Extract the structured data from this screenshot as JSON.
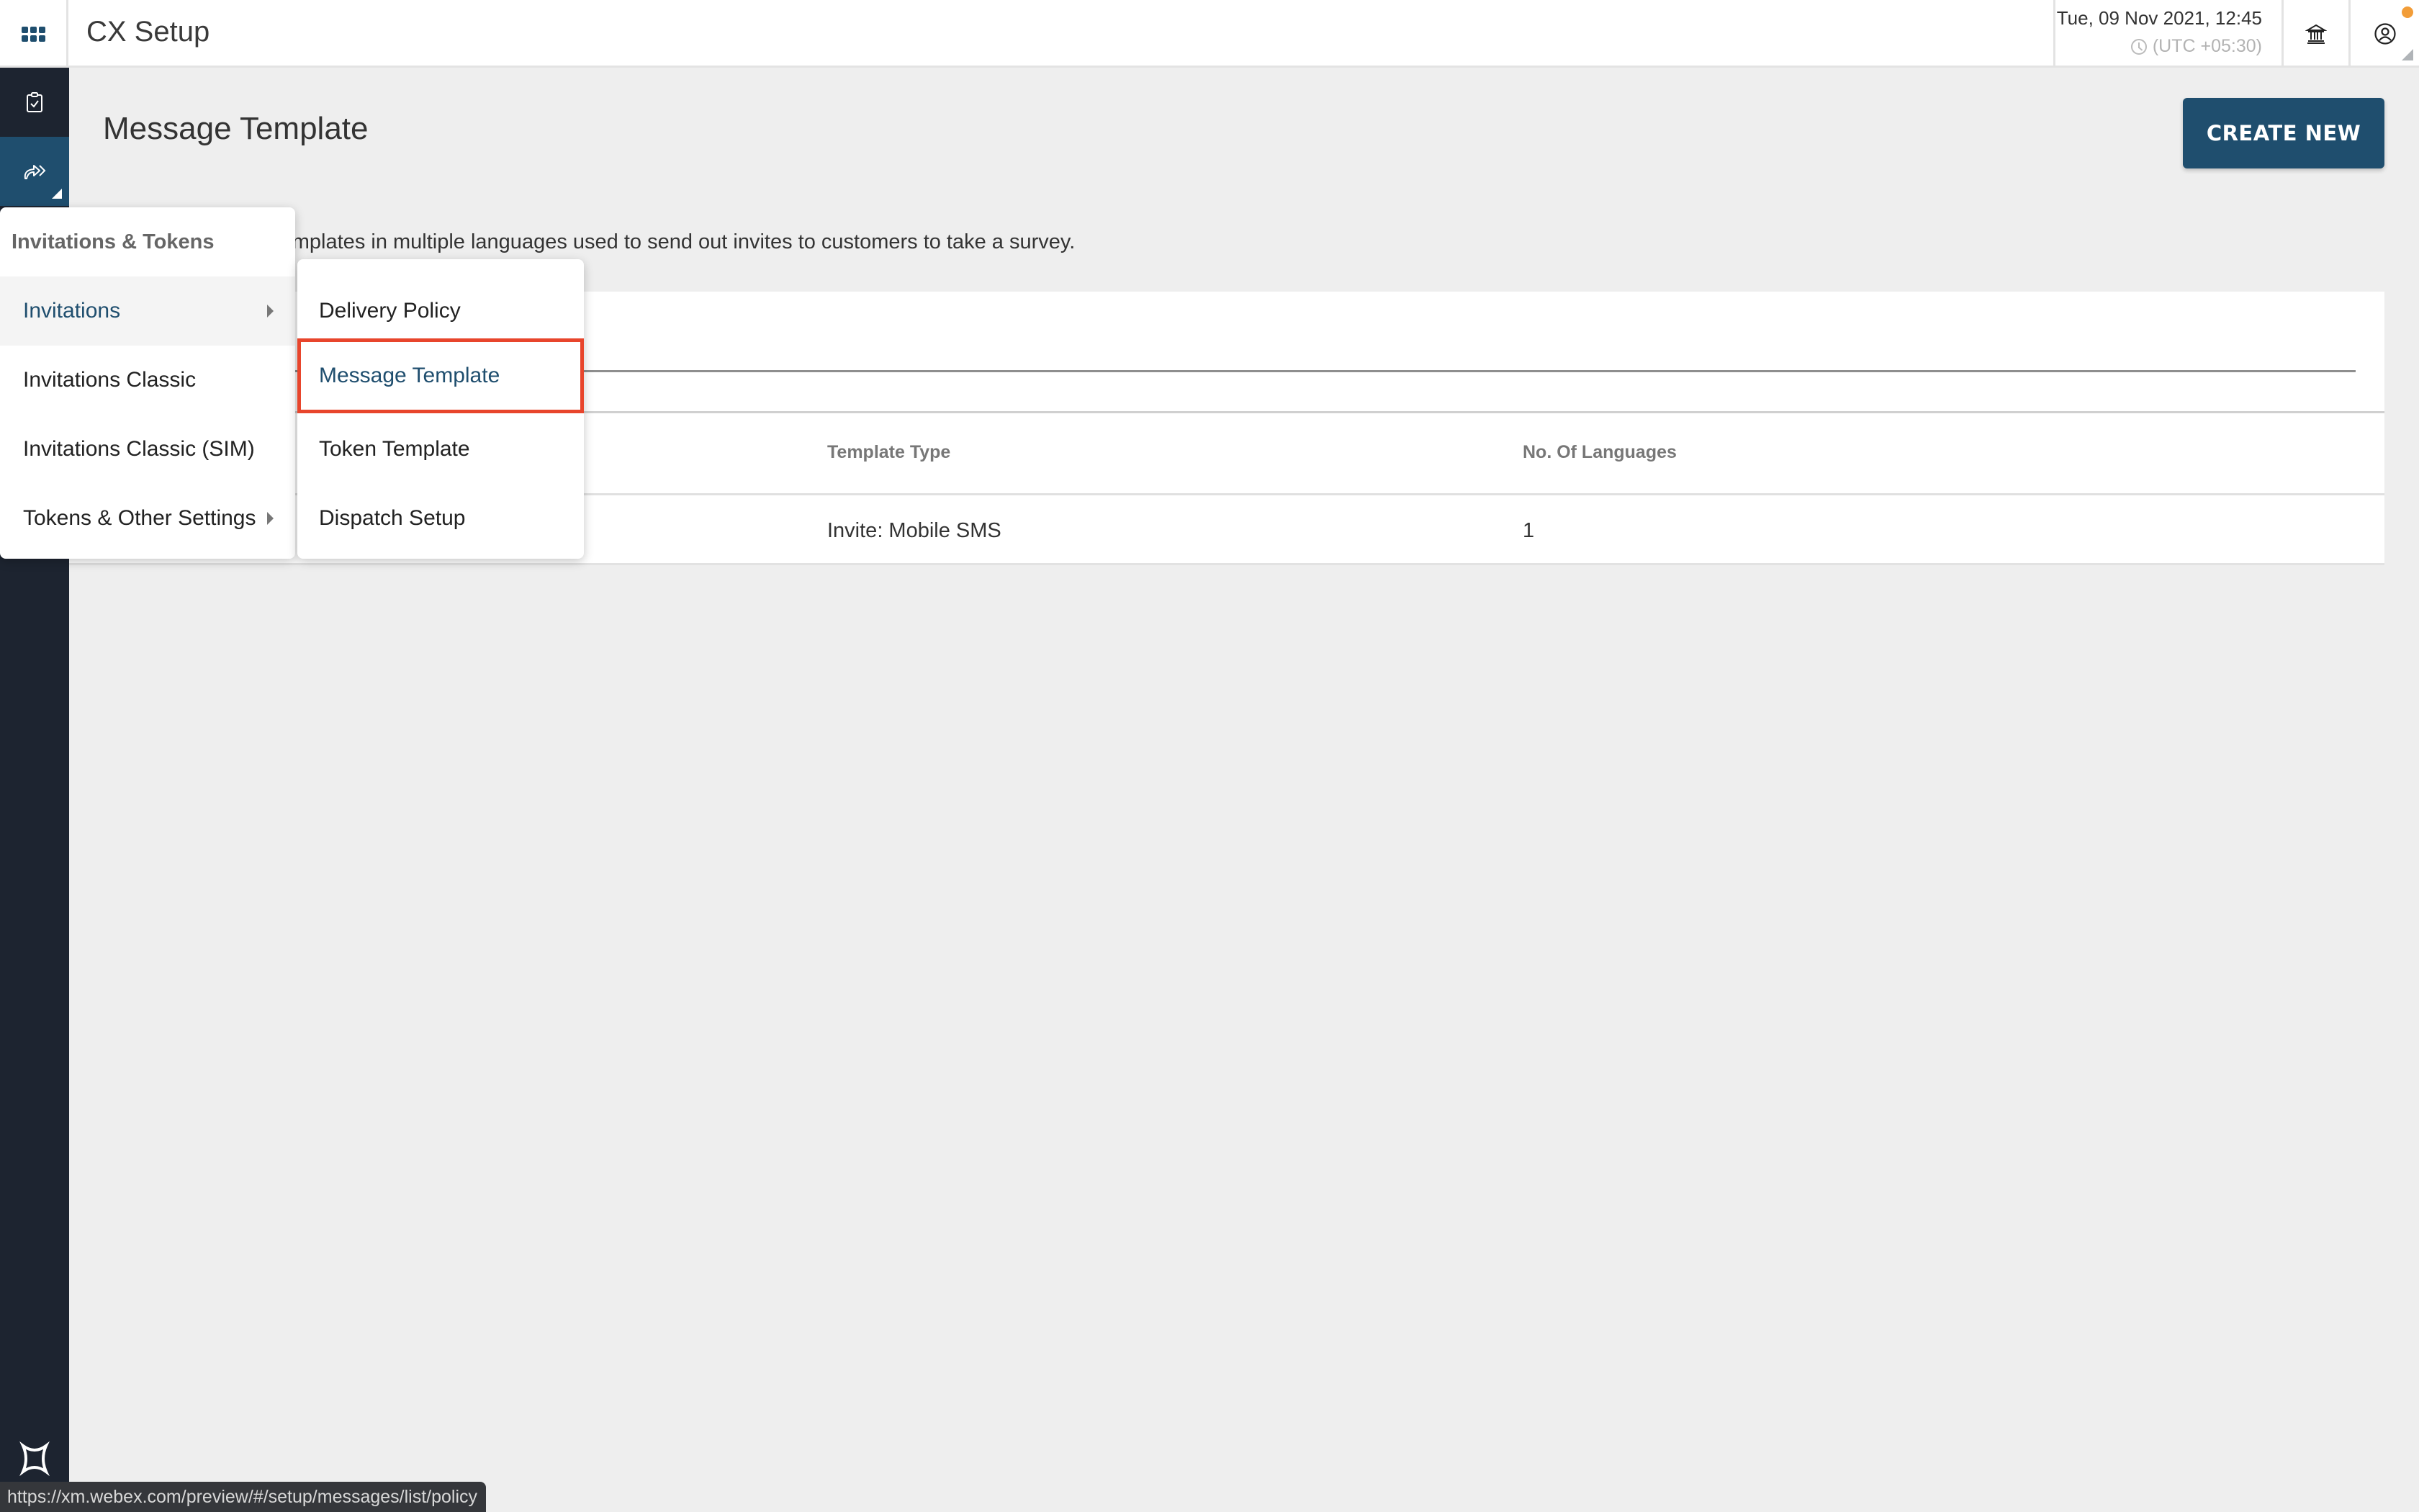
{
  "header": {
    "app_title": "CX Setup",
    "datetime": "Tue, 09 Nov 2021, 12:45",
    "timezone": "(UTC +05:30)",
    "icons": {
      "apps": "apps-grid-icon",
      "clock": "clock-icon",
      "organization": "bank-icon",
      "profile": "user-circle-icon"
    },
    "notification_color": "#f29d38"
  },
  "sidebar": {
    "items": [
      {
        "name": "surveys",
        "icon": "clipboard-check-icon",
        "active": false
      },
      {
        "name": "invitations",
        "icon": "share-forward-icon",
        "active": true
      }
    ],
    "logo": "webex-experience-logo"
  },
  "page": {
    "title": "Message Template",
    "create_button": "CREATE NEW",
    "description": "Manage message templates in multiple languages used to send out invites to customers to take a survey.",
    "description_visible": "age message templates in multiple languages used to send out invites to customers to take a survey.",
    "search": {
      "value": "",
      "placeholder": ""
    }
  },
  "table": {
    "columns": [
      "",
      "Template Type",
      "No. Of Languages"
    ],
    "rows": [
      {
        "name": "",
        "template_type": "Invite: Mobile SMS",
        "languages": "1"
      }
    ]
  },
  "menu": {
    "heading": "Invitations & Tokens",
    "items": [
      {
        "label": "Invitations",
        "has_submenu": true,
        "active": true
      },
      {
        "label": "Invitations Classic",
        "has_submenu": false,
        "active": false
      },
      {
        "label": "Invitations Classic (SIM)",
        "has_submenu": false,
        "active": false
      },
      {
        "label": "Tokens & Other Settings",
        "has_submenu": true,
        "active": false
      }
    ],
    "submenu": [
      {
        "label": "Delivery Policy",
        "selected": false
      },
      {
        "label": "Message Template",
        "selected": true
      },
      {
        "label": "Token Template",
        "selected": false
      },
      {
        "label": "Dispatch Setup",
        "selected": false
      }
    ]
  },
  "status_bar": {
    "url": "https://xm.webex.com/preview/#/setup/messages/list/policy"
  },
  "colors": {
    "brand": "#1f4e6e",
    "sidebar_bg": "#1d2430",
    "highlight_border": "#e8452c",
    "page_bg": "#eeeeee"
  }
}
